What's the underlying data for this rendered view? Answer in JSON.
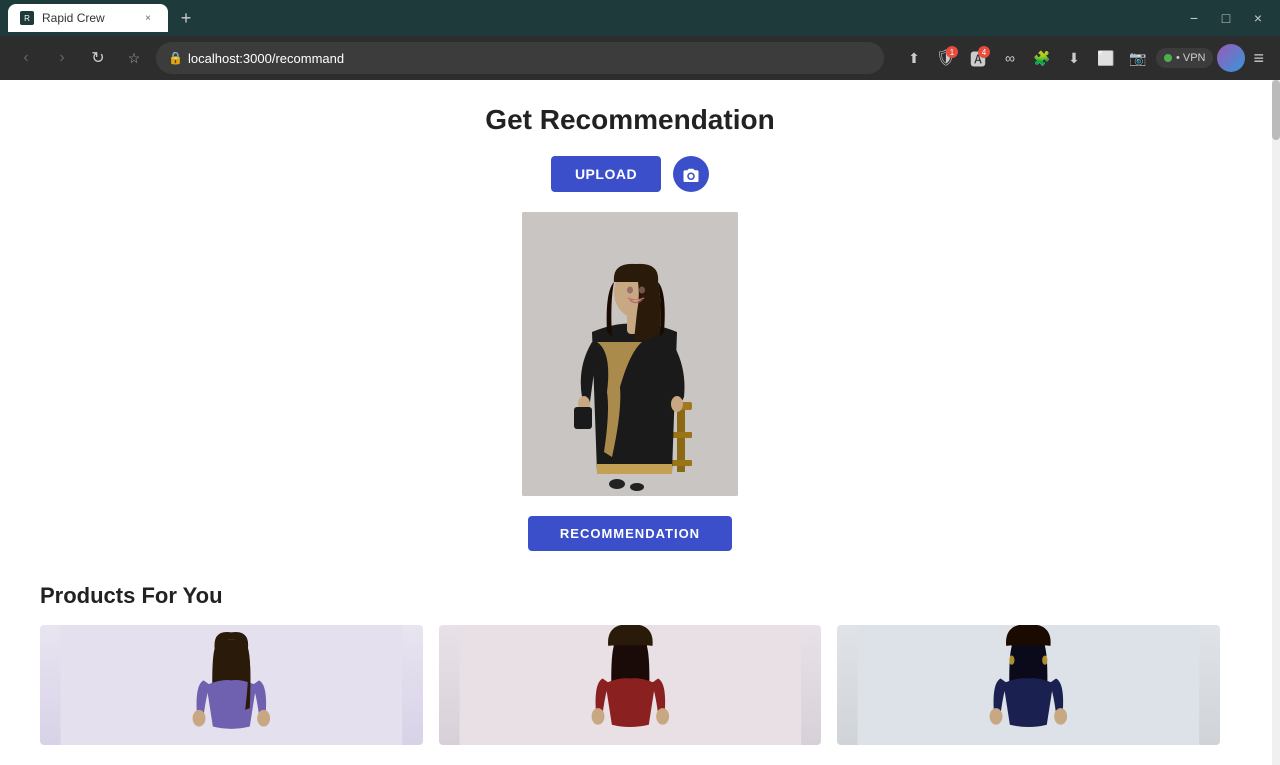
{
  "browser": {
    "tab": {
      "favicon_text": "R",
      "title": "Rapid Crew",
      "close_label": "×"
    },
    "new_tab_label": "+",
    "window_controls": {
      "minimize": "−",
      "maximize": "□",
      "close": "×"
    },
    "nav": {
      "back_label": "‹",
      "forward_label": "›",
      "reload_label": "↻"
    },
    "address": "localhost:3000/recommand",
    "bookmark_label": "☆",
    "toolbar": {
      "share_label": "⬆",
      "ext1_label": "🔗",
      "ext2_label": "🔧",
      "download_label": "⬇",
      "screenshot_label": "⬜",
      "puzzle_label": "🧩",
      "badge1": "1",
      "badge2": "4"
    },
    "vpn_label": "• VPN",
    "menu_label": "≡"
  },
  "page": {
    "title": "Get Recommendation",
    "upload_button": "UPLOAD",
    "camera_icon_label": "📷",
    "recommendation_button": "RECOMMENDATION",
    "products_section_title": "Products For You",
    "products": [
      {
        "id": 1,
        "outfit_class": "outfit-purple",
        "alt": "Purple outfit model"
      },
      {
        "id": 2,
        "outfit_class": "outfit-red",
        "alt": "Red outfit model"
      },
      {
        "id": 3,
        "outfit_class": "outfit-dark",
        "alt": "Dark outfit model"
      }
    ]
  }
}
